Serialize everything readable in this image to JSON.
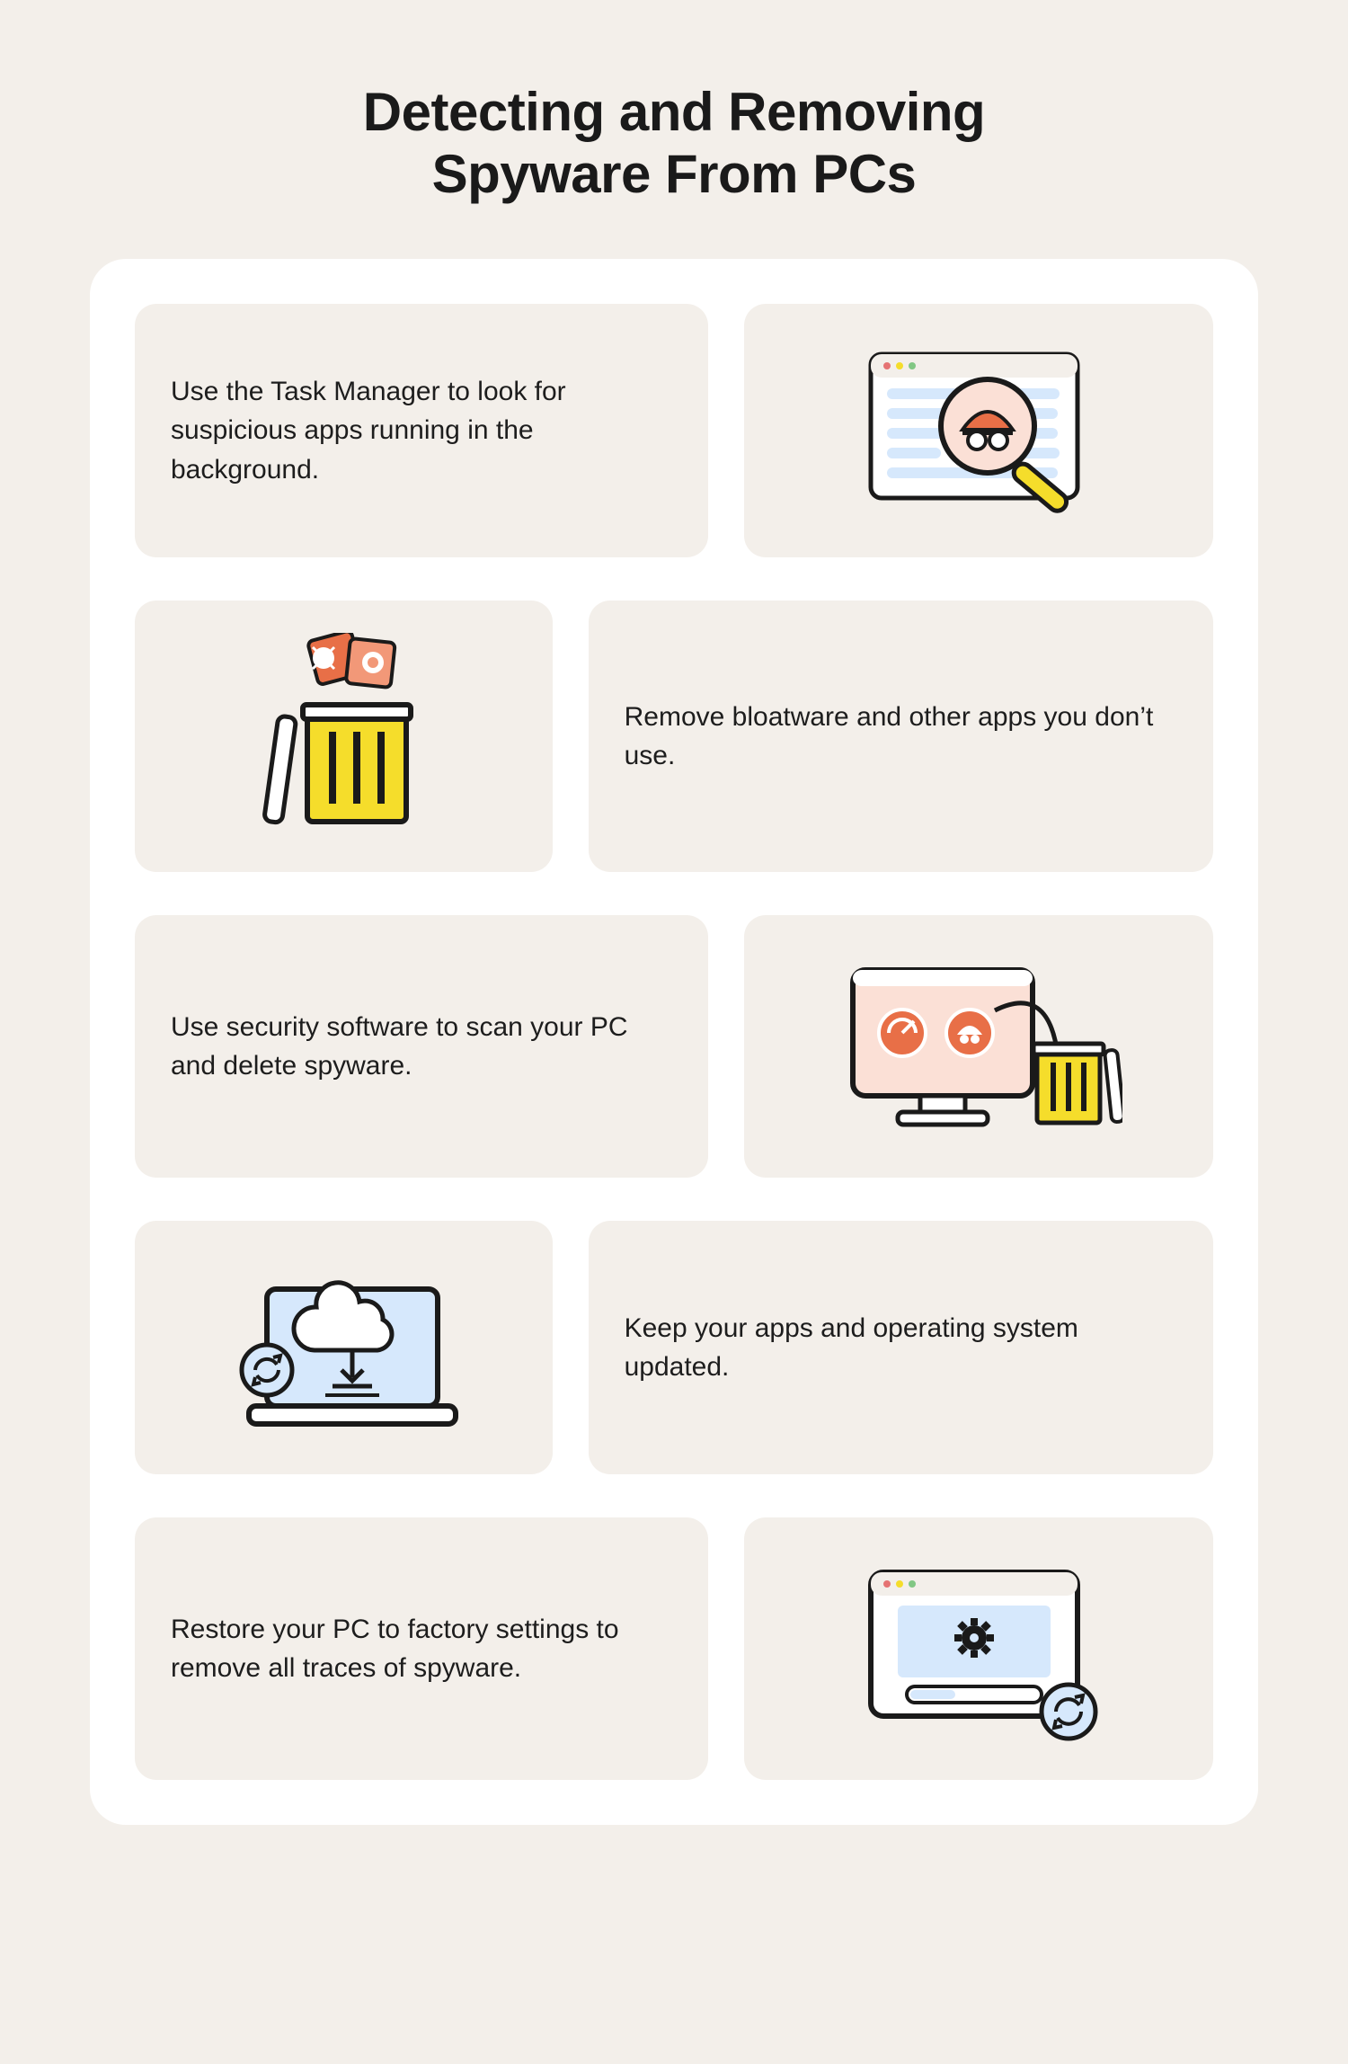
{
  "title_line1": "Detecting and Removing",
  "title_line2": "Spyware From PCs",
  "tips": {
    "task_manager": "Use the Task Manager to look for suspicious apps running in the background.",
    "bloatware": "Remove bloatware and other apps you don’t use.",
    "security_scan": "Use security software to scan your PC and delete spyware.",
    "update": "Keep your apps and operating system updated.",
    "factory_reset": "Restore your PC to factory settings to remove all traces of spyware."
  },
  "colors": {
    "bg": "#f3efea",
    "card": "#ffffff",
    "tile": "#f3efea",
    "text": "#1a1a1a",
    "yellow": "#f5dd2b",
    "coral": "#f29878",
    "coral_dark": "#e86f47",
    "pale_blue": "#d6e8fc",
    "stroke": "#1a1a1a"
  }
}
